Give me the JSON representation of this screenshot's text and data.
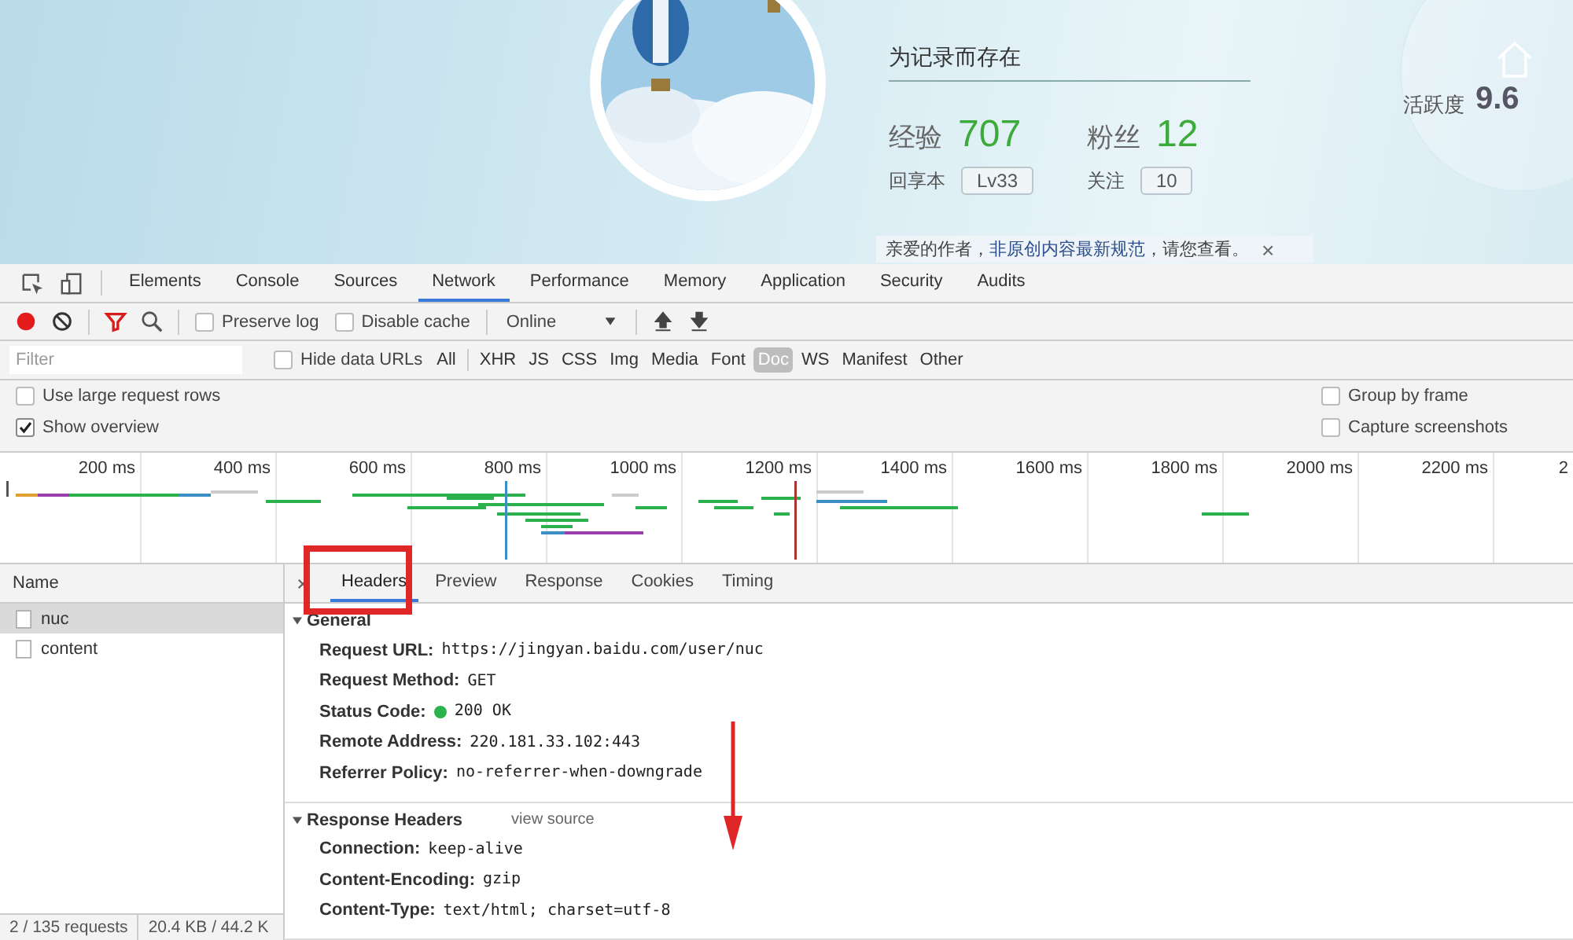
{
  "profile": {
    "motto": "为记录而存在",
    "stats": [
      {
        "label": "经验",
        "value": "707"
      },
      {
        "label": "粉丝",
        "value": "12"
      }
    ],
    "sub_stats": [
      {
        "label": "回享本",
        "value": "Lv33"
      },
      {
        "label": "关注",
        "value": "10"
      }
    ],
    "activity": {
      "label": "活跃度",
      "value": "9.6"
    },
    "notice": {
      "before": "亲爱的作者，",
      "link": "非原创内容最新规范",
      "after": "，请您查看。",
      "close": "×"
    }
  },
  "devtools": {
    "tabs": [
      {
        "label": "Elements",
        "selected": false
      },
      {
        "label": "Console",
        "selected": false
      },
      {
        "label": "Sources",
        "selected": false
      },
      {
        "label": "Network",
        "selected": true
      },
      {
        "label": "Performance",
        "selected": false
      },
      {
        "label": "Memory",
        "selected": false
      },
      {
        "label": "Application",
        "selected": false
      },
      {
        "label": "Security",
        "selected": false
      },
      {
        "label": "Audits",
        "selected": false
      }
    ],
    "recording": true,
    "toolbar_checks": [
      {
        "label": "Preserve log",
        "checked": false
      },
      {
        "label": "Disable cache",
        "checked": false
      }
    ],
    "throttle": "Online",
    "filter": {
      "placeholder": "Filter",
      "hide_data_urls": {
        "label": "Hide data URLs",
        "checked": false
      },
      "types": [
        {
          "label": "All",
          "selected": false
        },
        {
          "label": "XHR",
          "selected": false
        },
        {
          "label": "JS",
          "selected": false
        },
        {
          "label": "CSS",
          "selected": false
        },
        {
          "label": "Img",
          "selected": false
        },
        {
          "label": "Media",
          "selected": false
        },
        {
          "label": "Font",
          "selected": false
        },
        {
          "label": "Doc",
          "selected": true
        },
        {
          "label": "WS",
          "selected": false
        },
        {
          "label": "Manifest",
          "selected": false
        },
        {
          "label": "Other",
          "selected": false
        }
      ]
    },
    "options_left": [
      {
        "label": "Use large request rows",
        "checked": false
      },
      {
        "label": "Show overview",
        "checked": true
      }
    ],
    "options_right": [
      {
        "label": "Group by frame",
        "checked": false
      },
      {
        "label": "Capture screenshots",
        "checked": false
      }
    ],
    "timeline_ticks": [
      "200 ms",
      "400 ms",
      "600 ms",
      "800 ms",
      "1000 ms",
      "1200 ms",
      "1400 ms",
      "1600 ms",
      "1800 ms",
      "2000 ms",
      "2200 ms",
      "2"
    ],
    "name_header": "Name",
    "requests": [
      {
        "name": "nuc",
        "selected": true
      },
      {
        "name": "content",
        "selected": false
      }
    ],
    "status": [
      "2 / 135 requests",
      "20.4 KB / 44.2 K"
    ],
    "detail_tabs": [
      {
        "label": "Headers",
        "selected": true
      },
      {
        "label": "Preview",
        "selected": false
      },
      {
        "label": "Response",
        "selected": false
      },
      {
        "label": "Cookies",
        "selected": false
      },
      {
        "label": "Timing",
        "selected": false
      }
    ],
    "sections": [
      {
        "title": "General",
        "expanded": true,
        "rows": [
          {
            "key": "Request URL:",
            "value": "https://jingyan.baidu.com/user/nuc"
          },
          {
            "key": "Request Method:",
            "value": "GET"
          },
          {
            "key": "Status Code:",
            "value": "200 OK",
            "color": "#2bb24c"
          },
          {
            "key": "Remote Address:",
            "value": "220.181.33.102:443"
          },
          {
            "key": "Referrer Policy:",
            "value": "no-referrer-when-downgrade"
          }
        ]
      },
      {
        "title": "Response Headers",
        "expanded": true,
        "link": "view source",
        "rows": [
          {
            "key": "Connection:",
            "value": "keep-alive"
          },
          {
            "key": "Content-Encoding:",
            "value": "gzip"
          },
          {
            "key": "Content-Type:",
            "value": "text/html; charset=utf-8"
          }
        ]
      }
    ]
  }
}
